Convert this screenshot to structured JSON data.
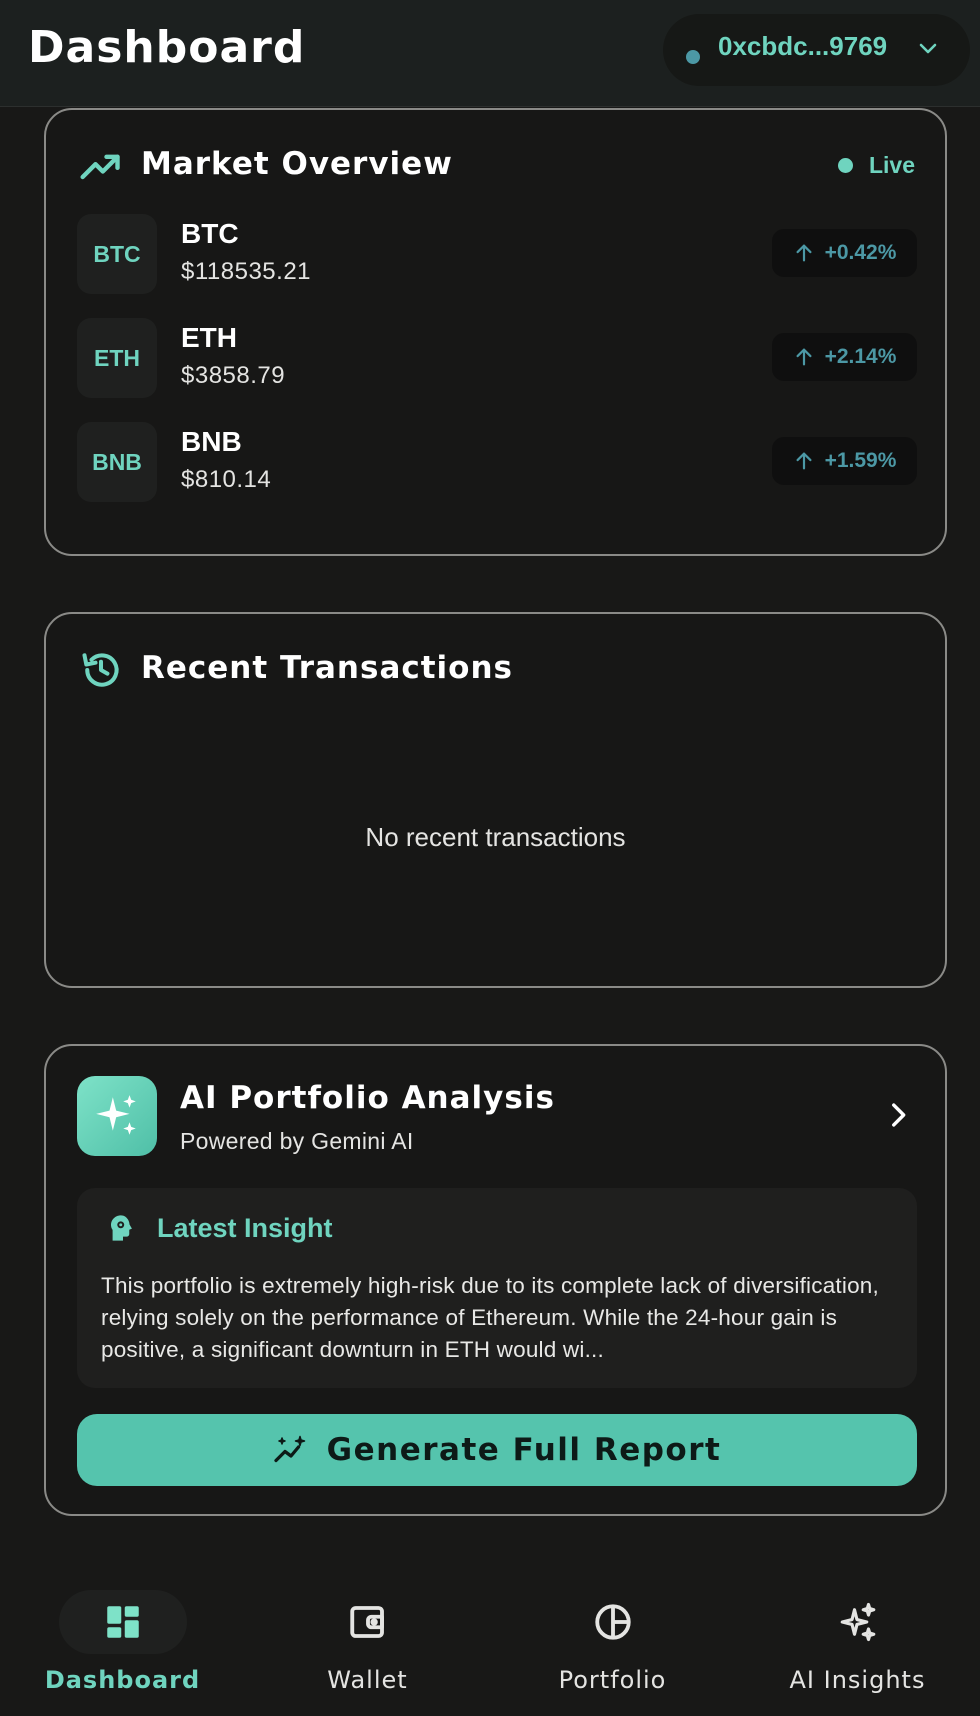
{
  "header": {
    "title": "Dashboard",
    "wallet_address": "0xcbdc...9769",
    "wallet_status_color": "#4c98a5"
  },
  "market": {
    "title": "Market Overview",
    "live_label": "Live",
    "coins": [
      {
        "badge": "BTC",
        "name": "BTC",
        "price": "$118535.21",
        "change": "+0.42%"
      },
      {
        "badge": "ETH",
        "name": "ETH",
        "price": "$3858.79",
        "change": "+2.14%"
      },
      {
        "badge": "BNB",
        "name": "BNB",
        "price": "$810.14",
        "change": "+1.59%"
      }
    ]
  },
  "transactions": {
    "title": "Recent Transactions",
    "empty_text": "No recent transactions"
  },
  "ai": {
    "title": "AI Portfolio Analysis",
    "subtitle": "Powered by Gemini AI",
    "insight_label": "Latest Insight",
    "insight_text": "This portfolio is extremely high-risk due to its complete lack of diversification, relying solely on the performance of Ethereum. While the 24-hour gain is positive, a significant downturn in ETH would wi...",
    "button_label": "Generate Full Report"
  },
  "nav": {
    "items": [
      {
        "label": "Dashboard",
        "icon": "dashboard-icon",
        "active": true
      },
      {
        "label": "Wallet",
        "icon": "wallet-icon",
        "active": false
      },
      {
        "label": "Portfolio",
        "icon": "pie-chart-icon",
        "active": false
      },
      {
        "label": "AI Insights",
        "icon": "sparkles-icon",
        "active": false
      }
    ]
  },
  "colors": {
    "accent": "#6fd4bf",
    "positive": "#4c98a5",
    "button": "#55c4ad",
    "background": "#181817"
  }
}
